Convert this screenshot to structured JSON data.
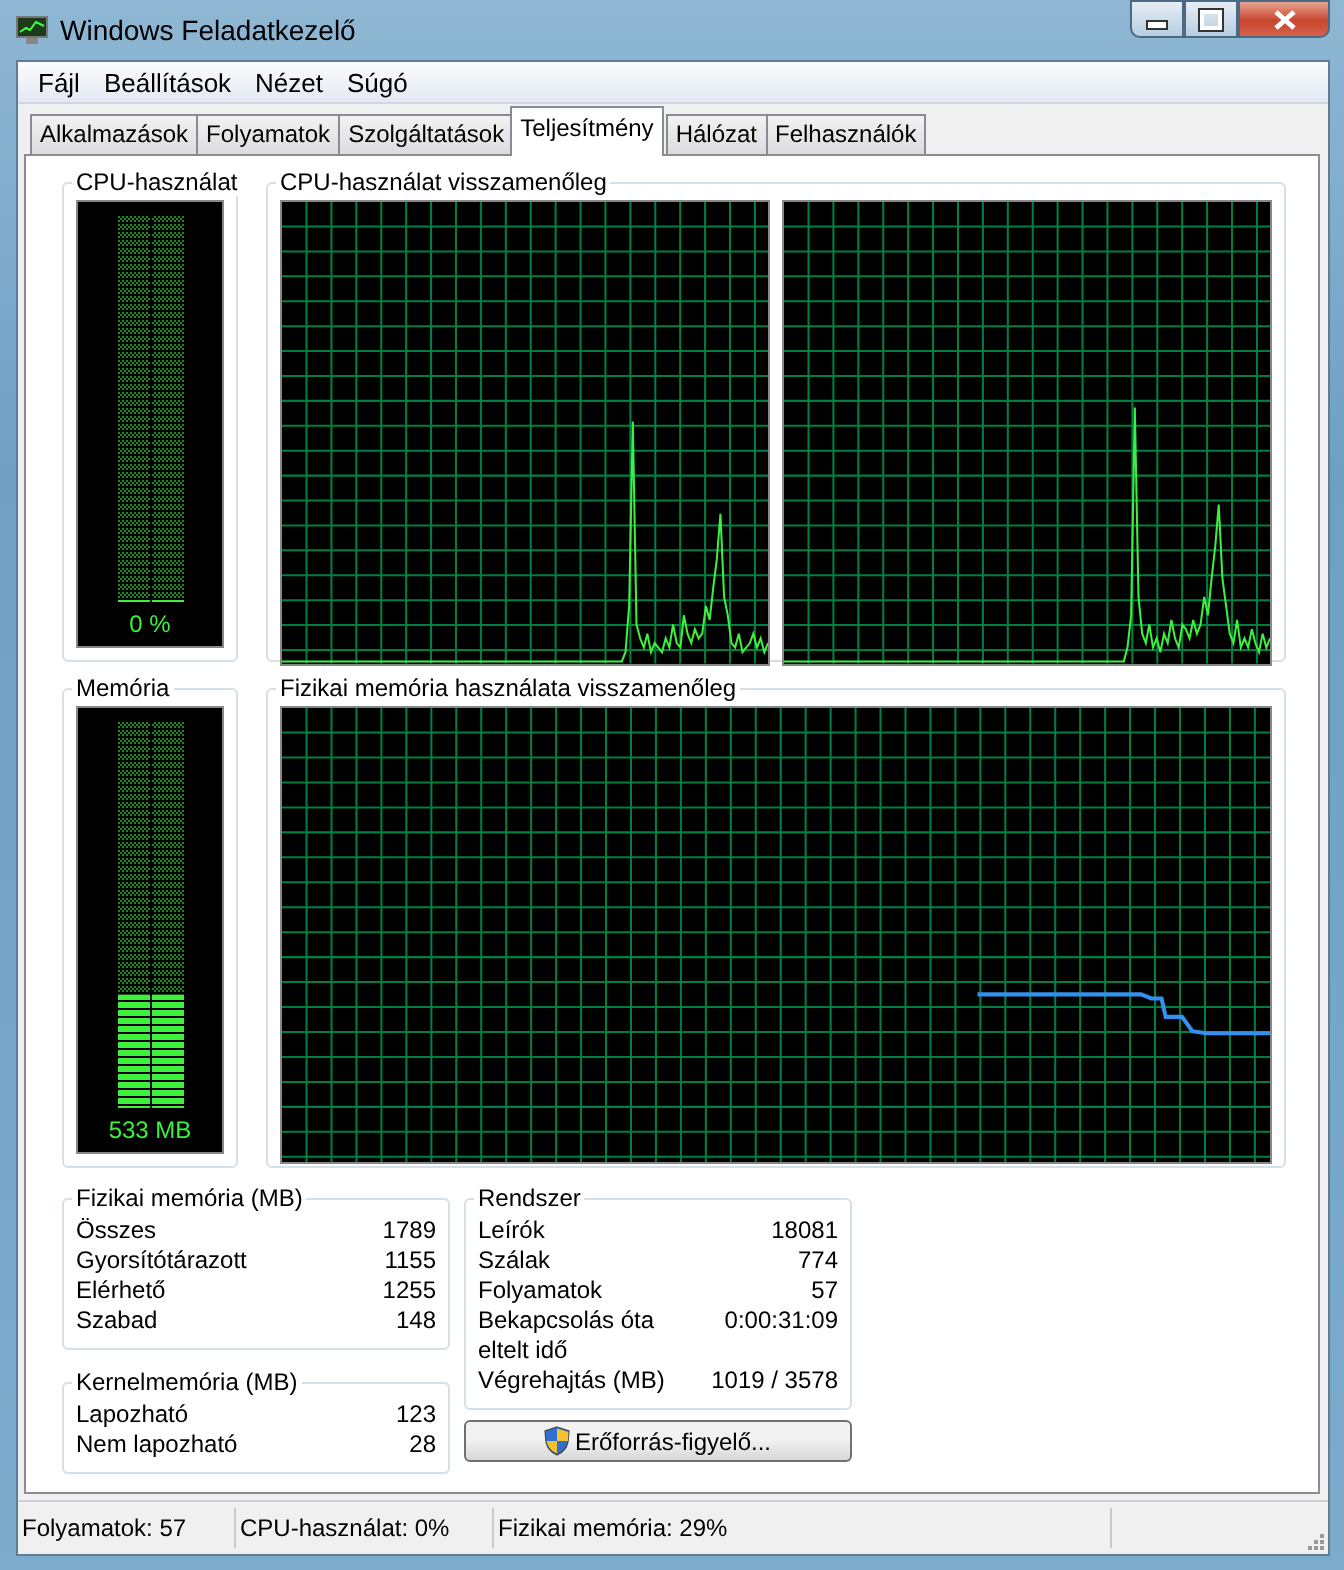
{
  "window": {
    "title": "Windows Feladatkezelő"
  },
  "menu": [
    "Fájl",
    "Beállítások",
    "Nézet",
    "Súgó"
  ],
  "tabs": [
    {
      "label": "Alkalmazások",
      "selected": false
    },
    {
      "label": "Folyamatok",
      "selected": false
    },
    {
      "label": "Szolgáltatások",
      "selected": false
    },
    {
      "label": "Teljesítmény",
      "selected": true
    },
    {
      "label": "Hálózat",
      "selected": false
    },
    {
      "label": "Felhasználók",
      "selected": false
    }
  ],
  "cpu_usage": {
    "title": "CPU-használat",
    "level": 0,
    "reading": "0 %"
  },
  "cpu_history": {
    "title": "CPU-használat visszamenőleg"
  },
  "memory": {
    "title": "Memória",
    "level": 0.29,
    "reading": "533 MB"
  },
  "memory_history": {
    "title": "Fizikai memória használata visszamenőleg"
  },
  "physical_memory": {
    "title": "Fizikai memória (MB)",
    "rows": [
      {
        "label": "Összes",
        "value": "1789"
      },
      {
        "label": "Gyorsítótárazott",
        "value": "1155"
      },
      {
        "label": "Elérhető",
        "value": "1255"
      },
      {
        "label": "Szabad",
        "value": "148"
      }
    ]
  },
  "kernel_memory": {
    "title": "Kernelmemória (MB)",
    "rows": [
      {
        "label": "Lapozható",
        "value": "123"
      },
      {
        "label": "Nem lapozható",
        "value": "28"
      }
    ]
  },
  "system": {
    "title": "Rendszer",
    "rows": [
      {
        "label": "Leírók",
        "value": "18081"
      },
      {
        "label": "Szálak",
        "value": "774"
      },
      {
        "label": "Folyamatok",
        "value": "57"
      },
      {
        "label": "Bekapcsolás óta eltelt idő",
        "value": "0:00:31:09"
      },
      {
        "label": "Végrehajtás (MB)",
        "value": "1019 / 3578"
      }
    ]
  },
  "resource_monitor_button": {
    "label": "Erőforrás-figyelő..."
  },
  "status_bar": [
    "Folyamatok: 57",
    "CPU-használat: 0%",
    "Fizikai memória: 29%"
  ]
}
